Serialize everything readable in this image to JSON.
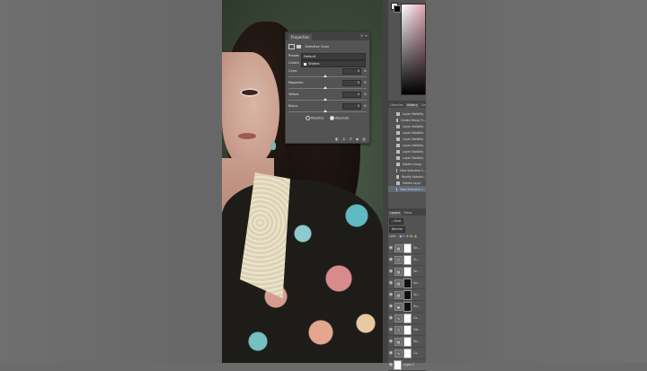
{
  "properties": {
    "title": "Properties",
    "adjustment": "Selective Color",
    "preset_label": "Preset:",
    "preset_value": "Default",
    "colors_label": "Colors:",
    "colors_value": "Whites",
    "sliders": [
      {
        "label": "Cyan:",
        "value": "0",
        "unit": "%"
      },
      {
        "label": "Magenta:",
        "value": "0",
        "unit": "%"
      },
      {
        "label": "Yellow:",
        "value": "0",
        "unit": "%"
      },
      {
        "label": "Black:",
        "value": "0",
        "unit": "%"
      }
    ],
    "relative_label": "Relative",
    "absolute_label": "Absolute",
    "method_selected": "Absolute"
  },
  "color": {
    "foreground": "#ffffff",
    "background": "#000000"
  },
  "history_panel": {
    "tabs": [
      "Libraries",
      "History",
      "Sw"
    ],
    "active_tab": "History",
    "items": [
      {
        "label": "Layer Visibility",
        "selected": false
      },
      {
        "label": "Create Group Fr...",
        "selected": false
      },
      {
        "label": "Layer Visibility",
        "selected": false
      },
      {
        "label": "Layer Visibility",
        "selected": false
      },
      {
        "label": "Layer Visibility",
        "selected": false
      },
      {
        "label": "Layer Visibility",
        "selected": false
      },
      {
        "label": "Layer Visibility",
        "selected": false
      },
      {
        "label": "Layer Visibility",
        "selected": false
      },
      {
        "label": "Delete Group",
        "selected": false
      },
      {
        "label": "New Selective C...",
        "selected": false
      },
      {
        "label": "Modify Selectiv...",
        "selected": false
      },
      {
        "label": "Delete Layer",
        "selected": false
      },
      {
        "label": "New Selective C...",
        "selected": true
      }
    ]
  },
  "layers_panel": {
    "tabs": [
      "Layers",
      "Paths"
    ],
    "active_tab": "Layers",
    "kind_filter": "Kind",
    "blend_mode": "Normal",
    "lock_label": "Lock:",
    "layers": [
      {
        "name": "Se...",
        "adj_icon": "selective-color-icon",
        "mask": "white"
      },
      {
        "name": "Gr...",
        "adj_icon": "gradient-map-icon",
        "mask": "white"
      },
      {
        "name": "Se...",
        "adj_icon": "selective-color-icon",
        "mask": "white"
      },
      {
        "name": "Se...",
        "adj_icon": "selective-color-icon",
        "mask": "black"
      },
      {
        "name": "Se...",
        "adj_icon": "selective-color-icon",
        "mask": "black"
      },
      {
        "name": "Hu...",
        "adj_icon": "hue-saturation-icon",
        "mask": "black"
      },
      {
        "name": "Co...",
        "adj_icon": "curves-icon",
        "mask": "white"
      },
      {
        "name": "Vib...",
        "adj_icon": "vibrance-icon",
        "mask": "white"
      },
      {
        "name": "Se...",
        "adj_icon": "selective-color-icon",
        "mask": "white"
      },
      {
        "name": "Cu...",
        "adj_icon": "curves-icon",
        "mask": "white"
      },
      {
        "name": "Layer 1",
        "adj_icon": "",
        "mask": "white"
      }
    ]
  }
}
